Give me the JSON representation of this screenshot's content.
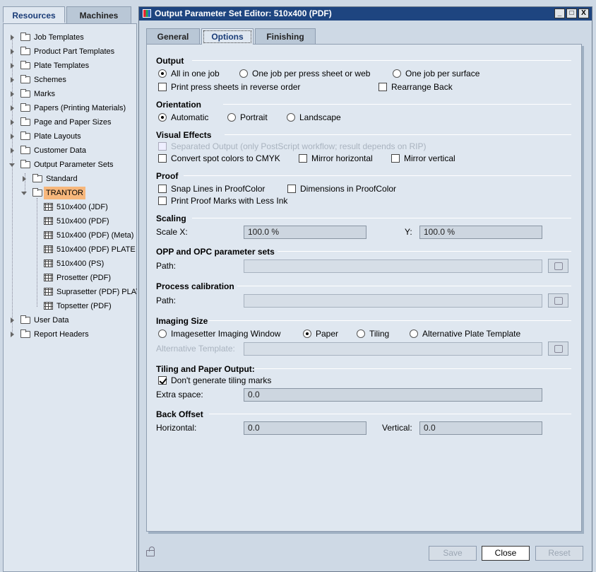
{
  "left_tabs": {
    "resources": "Resources",
    "machines": "Machines"
  },
  "tree": {
    "items": [
      {
        "label": "Job Templates"
      },
      {
        "label": "Product Part Templates"
      },
      {
        "label": "Plate Templates"
      },
      {
        "label": "Schemes"
      },
      {
        "label": "Marks"
      },
      {
        "label": "Papers (Printing Materials)"
      },
      {
        "label": "Page and Paper Sizes"
      },
      {
        "label": "Plate Layouts"
      },
      {
        "label": "Customer Data"
      },
      {
        "label": "Output Parameter Sets"
      },
      {
        "label": "Standard"
      },
      {
        "label": "TRANTOR"
      },
      {
        "label": "510x400 (JDF)"
      },
      {
        "label": "510x400 (PDF)"
      },
      {
        "label": "510x400 (PDF) (Meta)"
      },
      {
        "label": "510x400 (PDF) PLATE"
      },
      {
        "label": "510x400 (PS)"
      },
      {
        "label": "Prosetter (PDF)"
      },
      {
        "label": "Suprasetter (PDF) PLAT"
      },
      {
        "label": "Topsetter (PDF)"
      },
      {
        "label": "User Data"
      },
      {
        "label": "Report Headers"
      }
    ]
  },
  "dialog": {
    "title": "Output Parameter Set Editor: 510x400 (PDF)",
    "tabs": {
      "general": "General",
      "options": "Options",
      "finishing": "Finishing"
    }
  },
  "output": {
    "header": "Output",
    "all_in_one": "All in one job",
    "per_sheet": "One job per press sheet or web",
    "per_surface": "One job per surface",
    "reverse_order": "Print press sheets in reverse order",
    "rearrange_back": "Rearrange Back"
  },
  "orientation": {
    "header": "Orientation",
    "automatic": "Automatic",
    "portrait": "Portrait",
    "landscape": "Landscape"
  },
  "visual": {
    "header": "Visual Effects",
    "separated": "Separated Output (only PostScript workflow; result depends on RIP)",
    "spot_cmyk": "Convert spot colors to CMYK",
    "mirror_h": "Mirror horizontal",
    "mirror_v": "Mirror vertical"
  },
  "proof": {
    "header": "Proof",
    "snap": "Snap Lines in ProofColor",
    "dims": "Dimensions in ProofColor",
    "less_ink": "Print Proof Marks with Less Ink"
  },
  "scaling": {
    "header": "Scaling",
    "x_label": "Scale X:",
    "x_value": "100.0 %",
    "y_label": "Y:",
    "y_value": "100.0 %"
  },
  "opp": {
    "header": "OPP and OPC parameter sets",
    "path_label": "Path:",
    "path_value": ""
  },
  "calib": {
    "header": "Process calibration",
    "path_label": "Path:",
    "path_value": ""
  },
  "imaging": {
    "header": "Imaging Size",
    "window": "Imagesetter Imaging Window",
    "paper": "Paper",
    "tiling": "Tiling",
    "alt_plate": "Alternative Plate Template",
    "alt_label": "Alternative Template:",
    "alt_value": ""
  },
  "tiling": {
    "header": "Tiling and Paper Output:",
    "no_marks": "Don't generate tiling marks",
    "extra_label": "Extra space:",
    "extra_value": "0.0"
  },
  "back": {
    "header": "Back Offset",
    "h_label": "Horizontal:",
    "h_value": "0.0",
    "v_label": "Vertical:",
    "v_value": "0.0"
  },
  "buttons": {
    "save": "Save",
    "close": "Close",
    "reset": "Reset"
  },
  "window_controls": {
    "minimize": "_",
    "maximize": "□",
    "close": "X"
  }
}
